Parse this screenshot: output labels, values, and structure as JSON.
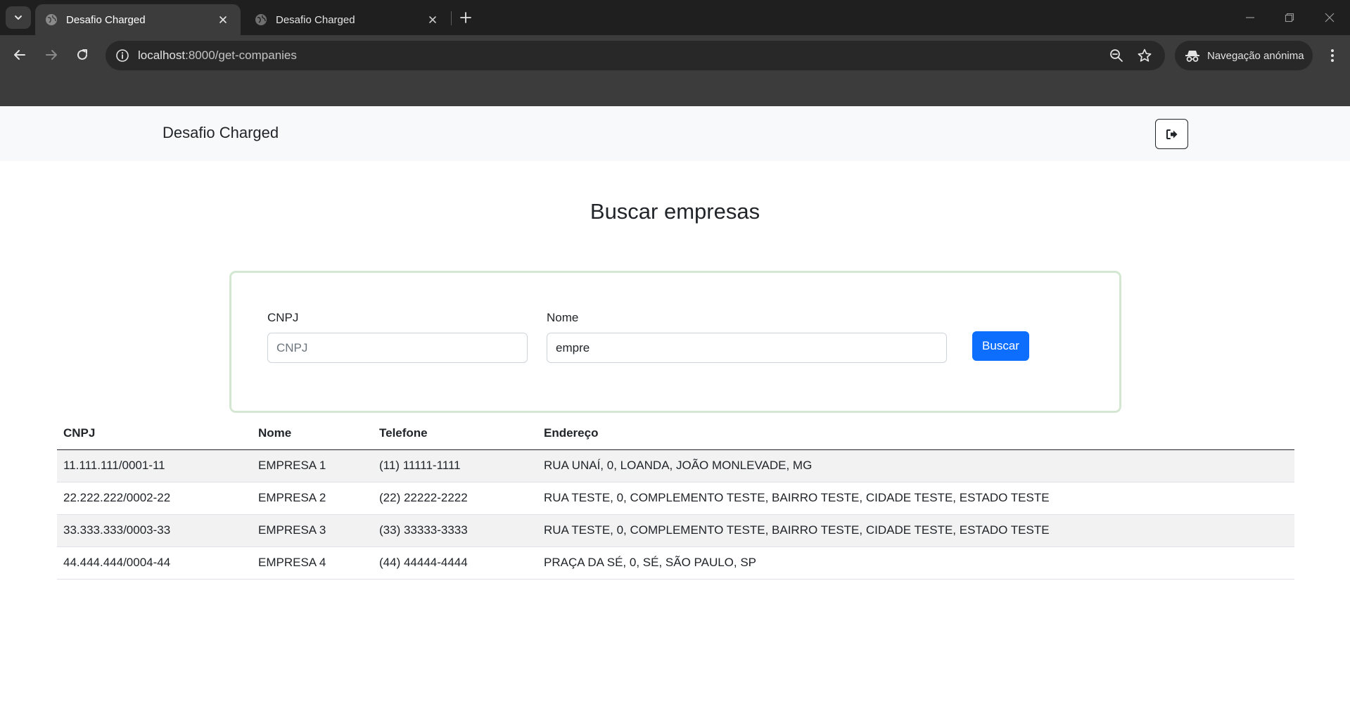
{
  "browser": {
    "tabs": [
      {
        "title": "Desafio Charged",
        "active": true
      },
      {
        "title": "Desafio Charged",
        "active": false
      }
    ],
    "url_host": "localhost",
    "url_rest": ":8000/get-companies",
    "incognito_label": "Navegação anónima"
  },
  "navbar": {
    "brand": "Desafio Charged",
    "logout_icon": "logout-icon"
  },
  "page": {
    "heading": "Buscar empresas"
  },
  "search": {
    "cnpj_label": "CNPJ",
    "cnpj_placeholder": "CNPJ",
    "cnpj_value": "",
    "nome_label": "Nome",
    "nome_value": "empre",
    "button_label": "Buscar"
  },
  "table": {
    "headers": [
      "CNPJ",
      "Nome",
      "Telefone",
      "Endereço"
    ],
    "rows": [
      [
        "11.111.111/0001-11",
        "EMPRESA 1",
        "(11) 11111-1111",
        "RUA UNAÍ, 0, LOANDA, JOÃO MONLEVADE, MG"
      ],
      [
        "22.222.222/0002-22",
        "EMPRESA 2",
        "(22) 22222-2222",
        "RUA TESTE, 0, COMPLEMENTO TESTE, BAIRRO TESTE, CIDADE TESTE, ESTADO TESTE"
      ],
      [
        "33.333.333/0003-33",
        "EMPRESA 3",
        "(33) 33333-3333",
        "RUA TESTE, 0, COMPLEMENTO TESTE, BAIRRO TESTE, CIDADE TESTE, ESTADO TESTE"
      ],
      [
        "44.444.444/0004-44",
        "EMPRESA 4",
        "(44) 44444-4444",
        "PRAÇA DA SÉ, 0, SÉ, SÃO PAULO, SP"
      ]
    ]
  },
  "colors": {
    "primary": "#0d6efd",
    "card_border": "#d4e7d2",
    "navbar_bg": "#f8f9fa"
  }
}
